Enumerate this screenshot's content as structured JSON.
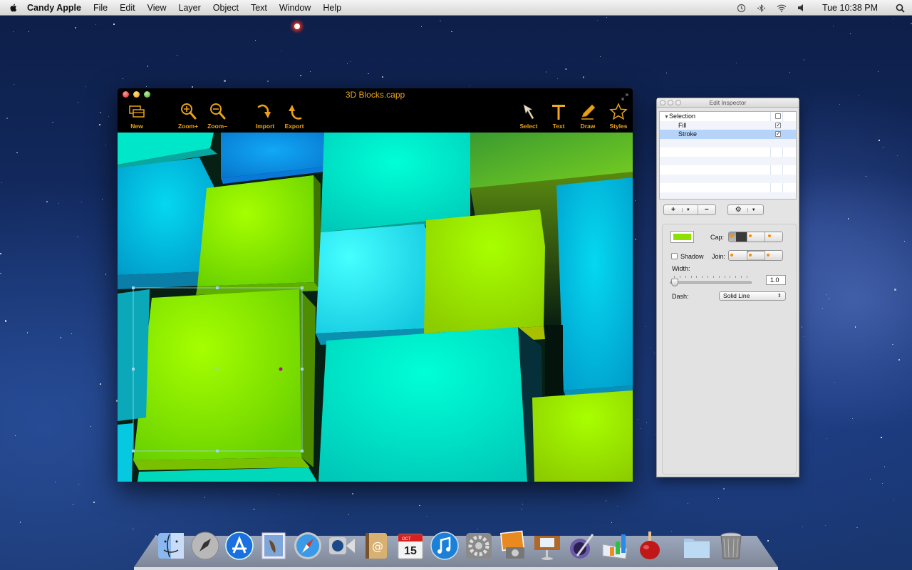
{
  "menubar": {
    "app_name": "Candy Apple",
    "menus": [
      "File",
      "Edit",
      "View",
      "Layer",
      "Object",
      "Text",
      "Window",
      "Help"
    ],
    "status_icons": [
      "time-machine-icon",
      "bluetooth-icon",
      "wifi-icon",
      "volume-icon"
    ],
    "clock": "Tue 10:38 PM"
  },
  "document_window": {
    "title": "3D Blocks.capp",
    "toolbar_left": [
      {
        "label": "New",
        "icon": "new-document-icon"
      },
      {
        "label": "Zoom+",
        "icon": "zoom-in-icon"
      },
      {
        "label": "Zoom–",
        "icon": "zoom-out-icon"
      },
      {
        "label": "Import",
        "icon": "import-arrow-icon"
      },
      {
        "label": "Export",
        "icon": "export-arrow-icon"
      }
    ],
    "toolbar_right": [
      {
        "label": "Select",
        "icon": "arrow-pointer-icon"
      },
      {
        "label": "Text",
        "icon": "text-tool-icon"
      },
      {
        "label": "Draw",
        "icon": "pencil-icon"
      },
      {
        "label": "Styles",
        "icon": "star-icon"
      }
    ],
    "accent_color": "#e8a21a"
  },
  "inspector": {
    "title": "Edit Inspector",
    "outline_rows": [
      {
        "label": "Selection",
        "expanded": true,
        "checked": false,
        "child": false,
        "selected": false
      },
      {
        "label": "Fill",
        "checked": true,
        "child": true,
        "selected": false
      },
      {
        "label": "Stroke",
        "checked": true,
        "child": true,
        "selected": true
      }
    ],
    "add_button": "+",
    "remove_button": "−",
    "stroke_color": "#8ee000",
    "cap_label": "Cap:",
    "cap_options": [
      "butt-cap",
      "round-cap",
      "square-cap"
    ],
    "cap_selected": 0,
    "shadow_label": "Shadow",
    "shadow_checked": false,
    "join_label": "Join:",
    "join_options": [
      "miter-join",
      "round-join",
      "bevel-join"
    ],
    "join_selected": 1,
    "width_label": "Width:",
    "width_value": "1.0",
    "width_slider_fraction": 0.02,
    "dash_label": "Dash:",
    "dash_value": "Solid Line"
  },
  "dock": {
    "apps": [
      "Finder",
      "Launchpad",
      "App Store",
      "Mail",
      "Safari",
      "FaceTime",
      "Address Book",
      "iCal",
      "iTunes",
      "System Preferences",
      "iPhoto",
      "Keynote",
      "Pages",
      "Numbers",
      "Candy Apple",
      "Documents",
      "Trash"
    ],
    "ical_month": "OCT",
    "ical_day": "15"
  }
}
